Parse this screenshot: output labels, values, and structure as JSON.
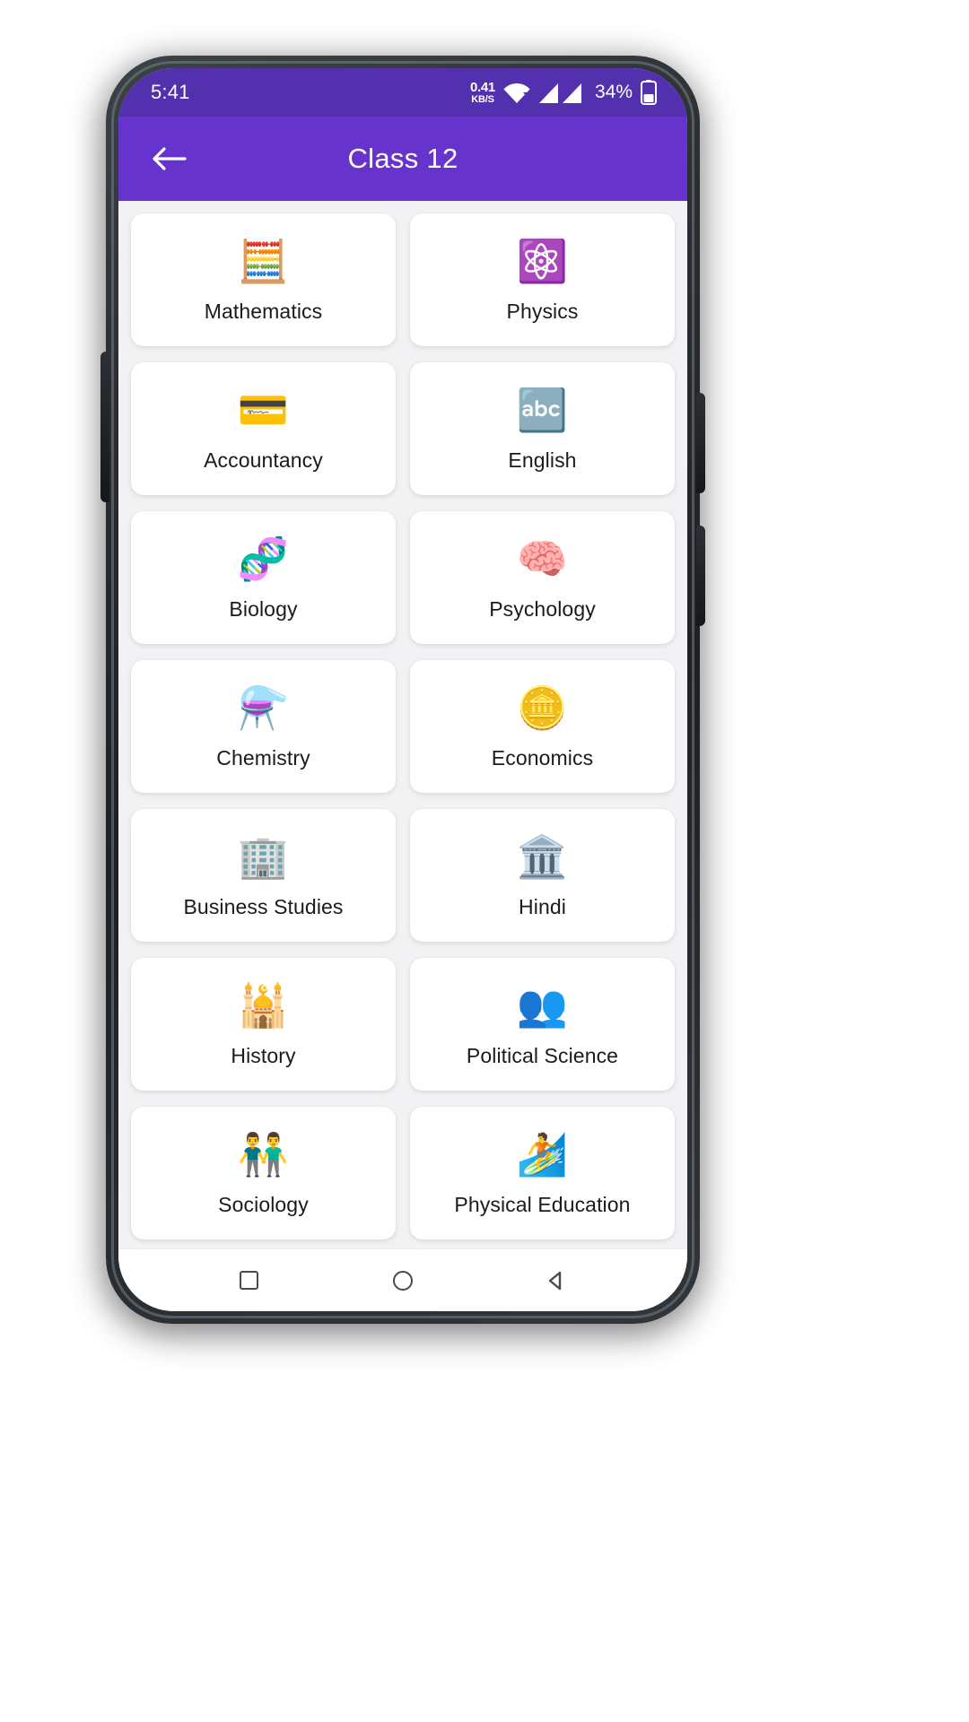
{
  "statusbar": {
    "time": "5:41",
    "net_speed_value": "0.41",
    "net_speed_unit": "KB/S",
    "wifi_icon": "wifi-icon",
    "signal_icon": "signal-bars-icon",
    "battery_text": "34%",
    "battery_icon": "battery-icon"
  },
  "appbar": {
    "back_icon": "back-arrow-icon",
    "title": "Class 12",
    "background_color": "#6633CC"
  },
  "theme": {
    "primary": "#6633CC",
    "status_bar": "#5330AD",
    "page_background": "#F2F2F4",
    "card_background": "#FFFFFF",
    "label_color": "#1B1B1B"
  },
  "subjects": [
    {
      "label": "Mathematics",
      "icon": "🧮",
      "icon_name": "calculator-icon"
    },
    {
      "label": "Physics",
      "icon": "⚛️",
      "icon_name": "atom-icon"
    },
    {
      "label": "Accountancy",
      "icon": "💳",
      "icon_name": "credit-card-icon"
    },
    {
      "label": "English",
      "icon": "🔤",
      "icon_name": "abc-letters-icon"
    },
    {
      "label": "Biology",
      "icon": "🧬",
      "icon_name": "dna-icon"
    },
    {
      "label": "Psychology",
      "icon": "🧠",
      "icon_name": "brain-icon"
    },
    {
      "label": "Chemistry",
      "icon": "⚗️",
      "icon_name": "flask-icon"
    },
    {
      "label": "Economics",
      "icon": "🪙",
      "icon_name": "gold-bars-icon"
    },
    {
      "label": "Business Studies",
      "icon": "🏢",
      "icon_name": "office-building-icon"
    },
    {
      "label": "Hindi",
      "icon": "🏛️",
      "icon_name": "classical-building-icon"
    },
    {
      "label": "History",
      "icon": "🕌",
      "icon_name": "taj-mahal-icon"
    },
    {
      "label": "Political Science",
      "icon": "👥",
      "icon_name": "group-people-icon"
    },
    {
      "label": "Sociology",
      "icon": "👬",
      "icon_name": "two-people-icon"
    },
    {
      "label": "Physical Education",
      "icon": "🏄",
      "icon_name": "surfer-icon"
    },
    {
      "label": "",
      "icon": "📘",
      "icon_name": "book-icon"
    },
    {
      "label": "",
      "icon": "🌍",
      "icon_name": "globe-icon"
    }
  ],
  "navbar": {
    "recents_label": "recents-square-icon",
    "home_label": "home-circle-icon",
    "back_label": "back-triangle-icon"
  }
}
